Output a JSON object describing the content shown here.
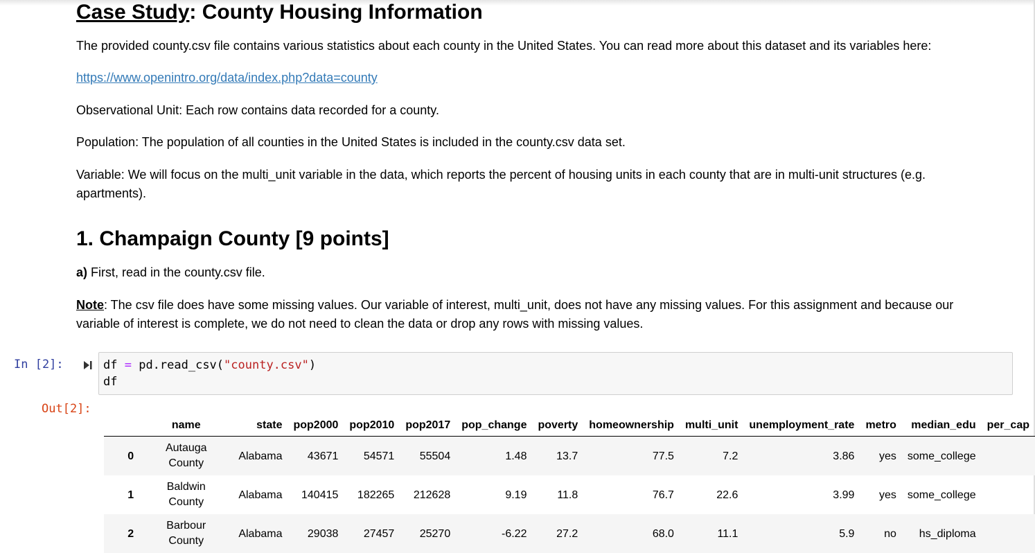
{
  "title": {
    "part1": "Case Study",
    "part2": ": County Housing Information"
  },
  "intro": "The provided county.csv file contains various statistics about each county in the United States. You can read more about this dataset and its variables here:",
  "link_text": "https://www.openintro.org/data/index.php?data=county",
  "observational_unit": "Observational Unit: Each row contains data recorded for a county.",
  "population": "Population: The population of all counties in the United States is included in the county.csv data set.",
  "variable": "Variable: We will focus on the multi_unit variable in the data, which reports the percent of housing units in each county that are in multi-unit structures (e.g. apartments).",
  "section_heading": "1. Champaign County [9 points]",
  "part_a": {
    "label": "a)",
    "text": " First, read in the county.csv file."
  },
  "note": {
    "label": "Note",
    "text": ": The csv file does have some missing values. Our variable of interest, multi_unit, does not have any missing values. For this assignment and because our variable of interest is complete, we do not need to clean the data or drop any rows with missing values."
  },
  "code_cell": {
    "in_prompt": "In [2]:",
    "out_prompt": "Out[2]:",
    "line1_a": "df ",
    "line1_op": "=",
    "line1_b": " pd.read_csv(",
    "line1_str": "\"county.csv\"",
    "line1_c": ")",
    "line2": "df"
  },
  "dataframe": {
    "columns": [
      "",
      "name",
      "state",
      "pop2000",
      "pop2010",
      "pop2017",
      "pop_change",
      "poverty",
      "homeownership",
      "multi_unit",
      "unemployment_rate",
      "metro",
      "median_edu",
      "per_cap"
    ],
    "rows": [
      {
        "index": "0",
        "name_l1": "Autauga",
        "name_l2": "County",
        "state": "Alabama",
        "pop2000": "43671",
        "pop2010": "54571",
        "pop2017": "55504",
        "pop_change": "1.48",
        "poverty": "13.7",
        "homeownership": "77.5",
        "multi_unit": "7.2",
        "unemployment_rate": "3.86",
        "metro": "yes",
        "median_edu": "some_college"
      },
      {
        "index": "1",
        "name_l1": "Baldwin",
        "name_l2": "County",
        "state": "Alabama",
        "pop2000": "140415",
        "pop2010": "182265",
        "pop2017": "212628",
        "pop_change": "9.19",
        "poverty": "11.8",
        "homeownership": "76.7",
        "multi_unit": "22.6",
        "unemployment_rate": "3.99",
        "metro": "yes",
        "median_edu": "some_college"
      },
      {
        "index": "2",
        "name_l1": "Barbour",
        "name_l2": "County",
        "state": "Alabama",
        "pop2000": "29038",
        "pop2010": "27457",
        "pop2017": "25270",
        "pop_change": "-6.22",
        "poverty": "27.2",
        "homeownership": "68.0",
        "multi_unit": "11.1",
        "unemployment_rate": "5.9",
        "metro": "no",
        "median_edu": "hs_diploma"
      }
    ]
  },
  "icons": {
    "run": "run-cell-icon"
  }
}
